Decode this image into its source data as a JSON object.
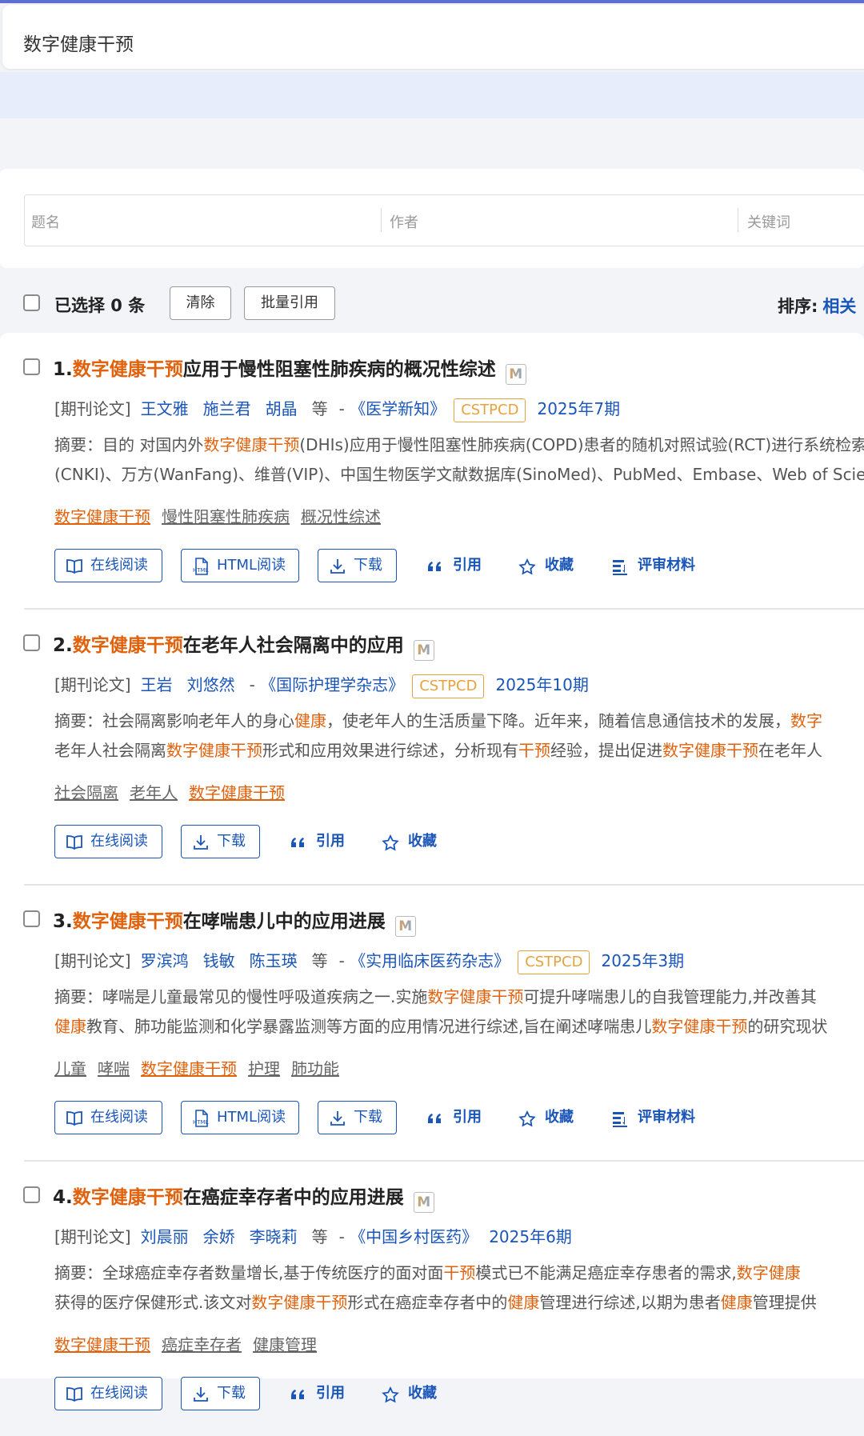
{
  "search": {
    "query": "数字健康干预"
  },
  "filters": {
    "title": "题名",
    "author": "作者",
    "keyword": "关键词"
  },
  "toolbar": {
    "selected": "已选择 0 条",
    "clear": "清除",
    "batch_cite": "批量引用",
    "sort_label": "排序:",
    "sort_value": "相关"
  },
  "labels": {
    "read_online": "在线阅读",
    "html_read": "HTML阅读",
    "download": "下载",
    "cite": "引用",
    "collect": "收藏",
    "review": "评审材料",
    "type": "[期刊论文]",
    "etal": "等",
    "dash": "-",
    "abstract_prefix": "摘要：",
    "cstpcd": "CSTPCD",
    "m_badge": "M"
  },
  "items": [
    {
      "num": "1.",
      "title_hl": "数字健康干预",
      "title_rest": "应用于慢性阻塞性肺疾病的概况性综述",
      "authors": [
        "王文雅",
        "施兰君",
        "胡晶"
      ],
      "etal": true,
      "journal": "《医学新知》",
      "cstpcd": true,
      "issue": "2025年7期",
      "abstract1": [
        {
          "t": "目的 对国内外",
          "h": false
        },
        {
          "t": "数字健康干预",
          "h": true
        },
        {
          "t": "(DHIs)应用于慢性阻塞性肺疾病(COPD)患者的随机对照试验(RCT)进行系统检索，检索中国知网",
          "h": false
        }
      ],
      "abstract2": [
        {
          "t": "(CNKI)、万方(WanFang)、维普(VIP)、中国生物医学文献数据库(SinoMed)、PubMed、Embase、Web of Science",
          "h": false
        }
      ],
      "keywords": [
        {
          "t": "数字健康干预",
          "h": true
        },
        {
          "t": "慢性阻塞性肺疾病",
          "h": false
        },
        {
          "t": "概况性综述",
          "h": false
        }
      ],
      "html": true,
      "review": true
    },
    {
      "num": "2.",
      "title_hl": "数字健康干预",
      "title_rest": "在老年人社会隔离中的应用",
      "authors": [
        "王岩",
        "刘悠然"
      ],
      "etal": false,
      "journal": "《国际护理学杂志》",
      "cstpcd": true,
      "issue": "2025年10期",
      "abstract1": [
        {
          "t": "社会隔离影响老年人的身心",
          "h": false
        },
        {
          "t": "健康",
          "h": true
        },
        {
          "t": "，使老年人的生活质量下降。近年来，随着信息通信技术的发展，",
          "h": false
        },
        {
          "t": "数字",
          "h": true
        }
      ],
      "abstract2": [
        {
          "t": "老年人社会隔离",
          "h": false
        },
        {
          "t": "数字健康干预",
          "h": true
        },
        {
          "t": "形式和应用效果进行综述，分析现有",
          "h": false
        },
        {
          "t": "干预",
          "h": true
        },
        {
          "t": "经验，提出促进",
          "h": false
        },
        {
          "t": "数字健康干预",
          "h": true
        },
        {
          "t": "在老年人",
          "h": false
        }
      ],
      "keywords": [
        {
          "t": "社会隔离",
          "h": false
        },
        {
          "t": "老年人",
          "h": false
        },
        {
          "t": "数字健康干预",
          "h": true
        }
      ],
      "html": false,
      "review": false
    },
    {
      "num": "3.",
      "title_hl": "数字健康干预",
      "title_rest": "在哮喘患儿中的应用进展",
      "authors": [
        "罗滨鸿",
        "钱敏",
        "陈玉瑛"
      ],
      "etal": true,
      "journal": "《实用临床医药杂志》",
      "cstpcd": true,
      "issue": "2025年3期",
      "abstract1": [
        {
          "t": "哮喘是儿童最常见的慢性呼吸道疾病之一.实施",
          "h": false
        },
        {
          "t": "数字健康干预",
          "h": true
        },
        {
          "t": "可提升哮喘患儿的自我管理能力,并改善其",
          "h": false
        }
      ],
      "abstract2": [
        {
          "t": "健康",
          "h": true
        },
        {
          "t": "教育、肺功能监测和化学暴露监测等方面的应用情况进行综述,旨在阐述哮喘患儿",
          "h": false
        },
        {
          "t": "数字健康干预",
          "h": true
        },
        {
          "t": "的研究现状",
          "h": false
        }
      ],
      "keywords": [
        {
          "t": "儿童",
          "h": false
        },
        {
          "t": "哮喘",
          "h": false
        },
        {
          "t": "数字健康干预",
          "h": true
        },
        {
          "t": "护理",
          "h": false
        },
        {
          "t": "肺功能",
          "h": false
        }
      ],
      "html": true,
      "review": true
    },
    {
      "num": "4.",
      "title_hl": "数字健康干预",
      "title_rest": "在癌症幸存者中的应用进展",
      "authors": [
        "刘晨丽",
        "余娇",
        "李晓莉"
      ],
      "etal": true,
      "journal": "《中国乡村医药》",
      "cstpcd": false,
      "issue": "2025年6期",
      "abstract1": [
        {
          "t": "全球癌症幸存者数量增长,基于传统医疗的面对面",
          "h": false
        },
        {
          "t": "干预",
          "h": true
        },
        {
          "t": "模式已不能满足癌症幸存患者的需求,",
          "h": false
        },
        {
          "t": "数字健康",
          "h": true
        }
      ],
      "abstract2": [
        {
          "t": "获得的医疗保健形式.该文对",
          "h": false
        },
        {
          "t": "数字健康干预",
          "h": true
        },
        {
          "t": "形式在癌症幸存者中的",
          "h": false
        },
        {
          "t": "健康",
          "h": true
        },
        {
          "t": "管理进行综述,以期为患者",
          "h": false
        },
        {
          "t": "健康",
          "h": true
        },
        {
          "t": "管理提供",
          "h": false
        }
      ],
      "keywords": [
        {
          "t": "数字健康干预",
          "h": true
        },
        {
          "t": "癌症幸存者",
          "h": false
        },
        {
          "t": "健康管理",
          "h": false
        }
      ],
      "html": false,
      "review": false
    }
  ]
}
